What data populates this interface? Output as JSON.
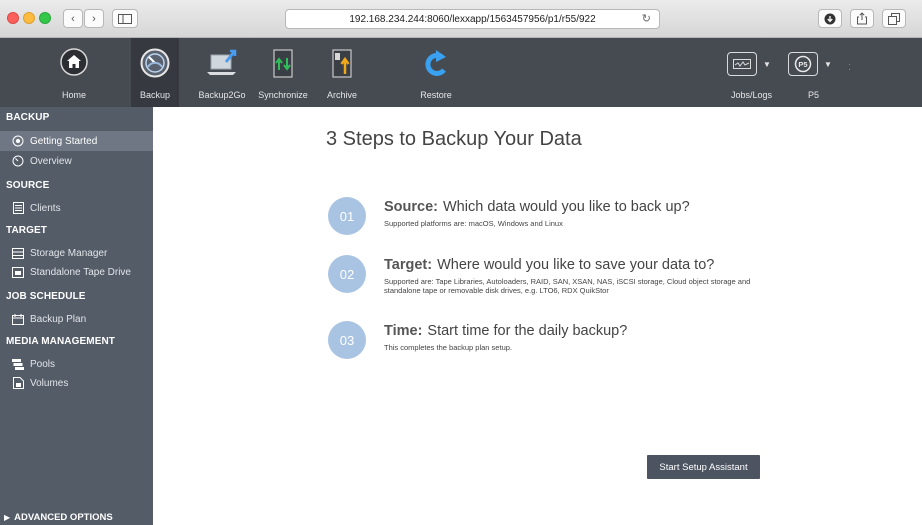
{
  "browser": {
    "url": "192.168.234.244:8060/lexxapp/1563457956/p1/r55/922",
    "back": "‹",
    "forward": "›"
  },
  "toolbar": {
    "items": [
      {
        "label": "Home"
      },
      {
        "label": "Backup"
      },
      {
        "label": "Backup2Go"
      },
      {
        "label": "Synchronize"
      },
      {
        "label": "Archive"
      },
      {
        "label": "Restore"
      }
    ],
    "jobs_label": "Jobs/Logs",
    "p5_label": "P5",
    "p5_badge": "P5"
  },
  "sidebar": {
    "sections": [
      {
        "title": "BACKUP",
        "items": [
          "Getting Started",
          "Overview"
        ]
      },
      {
        "title": "SOURCE",
        "items": [
          "Clients"
        ]
      },
      {
        "title": "TARGET",
        "items": [
          "Storage Manager",
          "Standalone Tape Drive"
        ]
      },
      {
        "title": "JOB SCHEDULE",
        "items": [
          "Backup Plan"
        ]
      },
      {
        "title": "MEDIA MANAGEMENT",
        "items": [
          "Pools",
          "Volumes"
        ]
      }
    ],
    "advanced": "ADVANCED OPTIONS"
  },
  "main": {
    "title": "3 Steps to Backup Your Data",
    "steps": [
      {
        "num": "01",
        "key": "Source:",
        "text": "Which data would you like to back up?",
        "sub": "Supported platforms are: macOS, Windows and Linux"
      },
      {
        "num": "02",
        "key": "Target:",
        "text": "Where would you like to save your data to?",
        "sub": "Supported are: Tape Libraries, Autoloaders, RAID, SAN, XSAN, NAS, iSCSI storage, Cloud object storage and standalone tape or removable disk drives, e.g. LTO6, RDX QuikStor"
      },
      {
        "num": "03",
        "key": "Time:",
        "text": "Start time for the daily backup?",
        "sub": "This completes the backup plan setup."
      }
    ],
    "button": "Start Setup Assistant"
  },
  "colors": {
    "toolbar": "#464b52",
    "sidebar": "#545c68",
    "sidebar_active": "#6e7783",
    "step_circle": "#a9c4e3",
    "button": "#4c5461"
  }
}
